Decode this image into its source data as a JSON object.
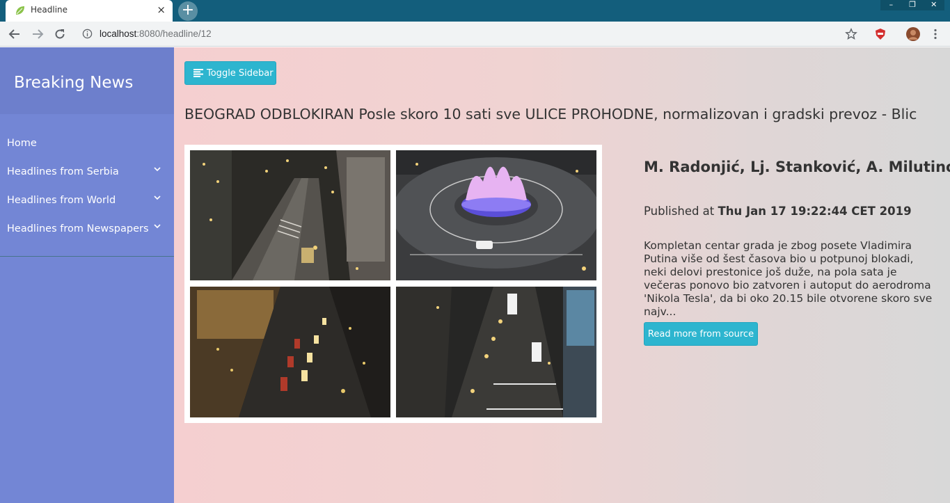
{
  "browser": {
    "tab_title": "Headline",
    "tab_close": "×",
    "new_tab": "+",
    "url_host": "localhost",
    "url_rest": ":8080/headline/12",
    "window_controls": [
      "–",
      "❐",
      "✕"
    ],
    "icons": [
      "leaf-favicon",
      "back-arrow-icon",
      "forward-arrow-icon",
      "reload-icon",
      "info-icon",
      "star-icon",
      "adblock-icon",
      "profile-avatar",
      "kebab-menu-icon"
    ]
  },
  "sidebar": {
    "title": "Breaking News",
    "items": [
      {
        "label": "Home",
        "has_submenu": false
      },
      {
        "label": "Headlines from Serbia",
        "has_submenu": true
      },
      {
        "label": "Headlines from World",
        "has_submenu": true
      },
      {
        "label": "Headlines from Newspapers",
        "has_submenu": true
      }
    ]
  },
  "main": {
    "toggle_label": "Toggle Sidebar",
    "headline": "BEOGRAD ODBLOKIRAN Posle skoro 10 sati sve ULICE PROHODNE, normalizovan i gradski prevoz - Blic",
    "author": "M. Radonjić, Lj. Stanković, A. Milutinović",
    "published_prefix": "Published at",
    "published_date": "Thu Jan 17 19:22:44 CET 2019",
    "summary": "Kompletan centar grada je zbog posete Vladimira Putina više od šest časova bio u potpunoj blokadi, neki delovi prestonice još duže, na pola sata je večeras ponovo bio zatvoren i autoput do aerodroma 'Nikola Tesla', da bi oko 20.15 bile otvorene skoro sve najv...",
    "read_more_label": "Read more from source"
  },
  "colors": {
    "sidebar_bg": "#7386d5",
    "sidebar_header_bg": "#6d7fcc",
    "button_bg": "#2db5cf",
    "titlebar_bg": "#135e7c"
  }
}
